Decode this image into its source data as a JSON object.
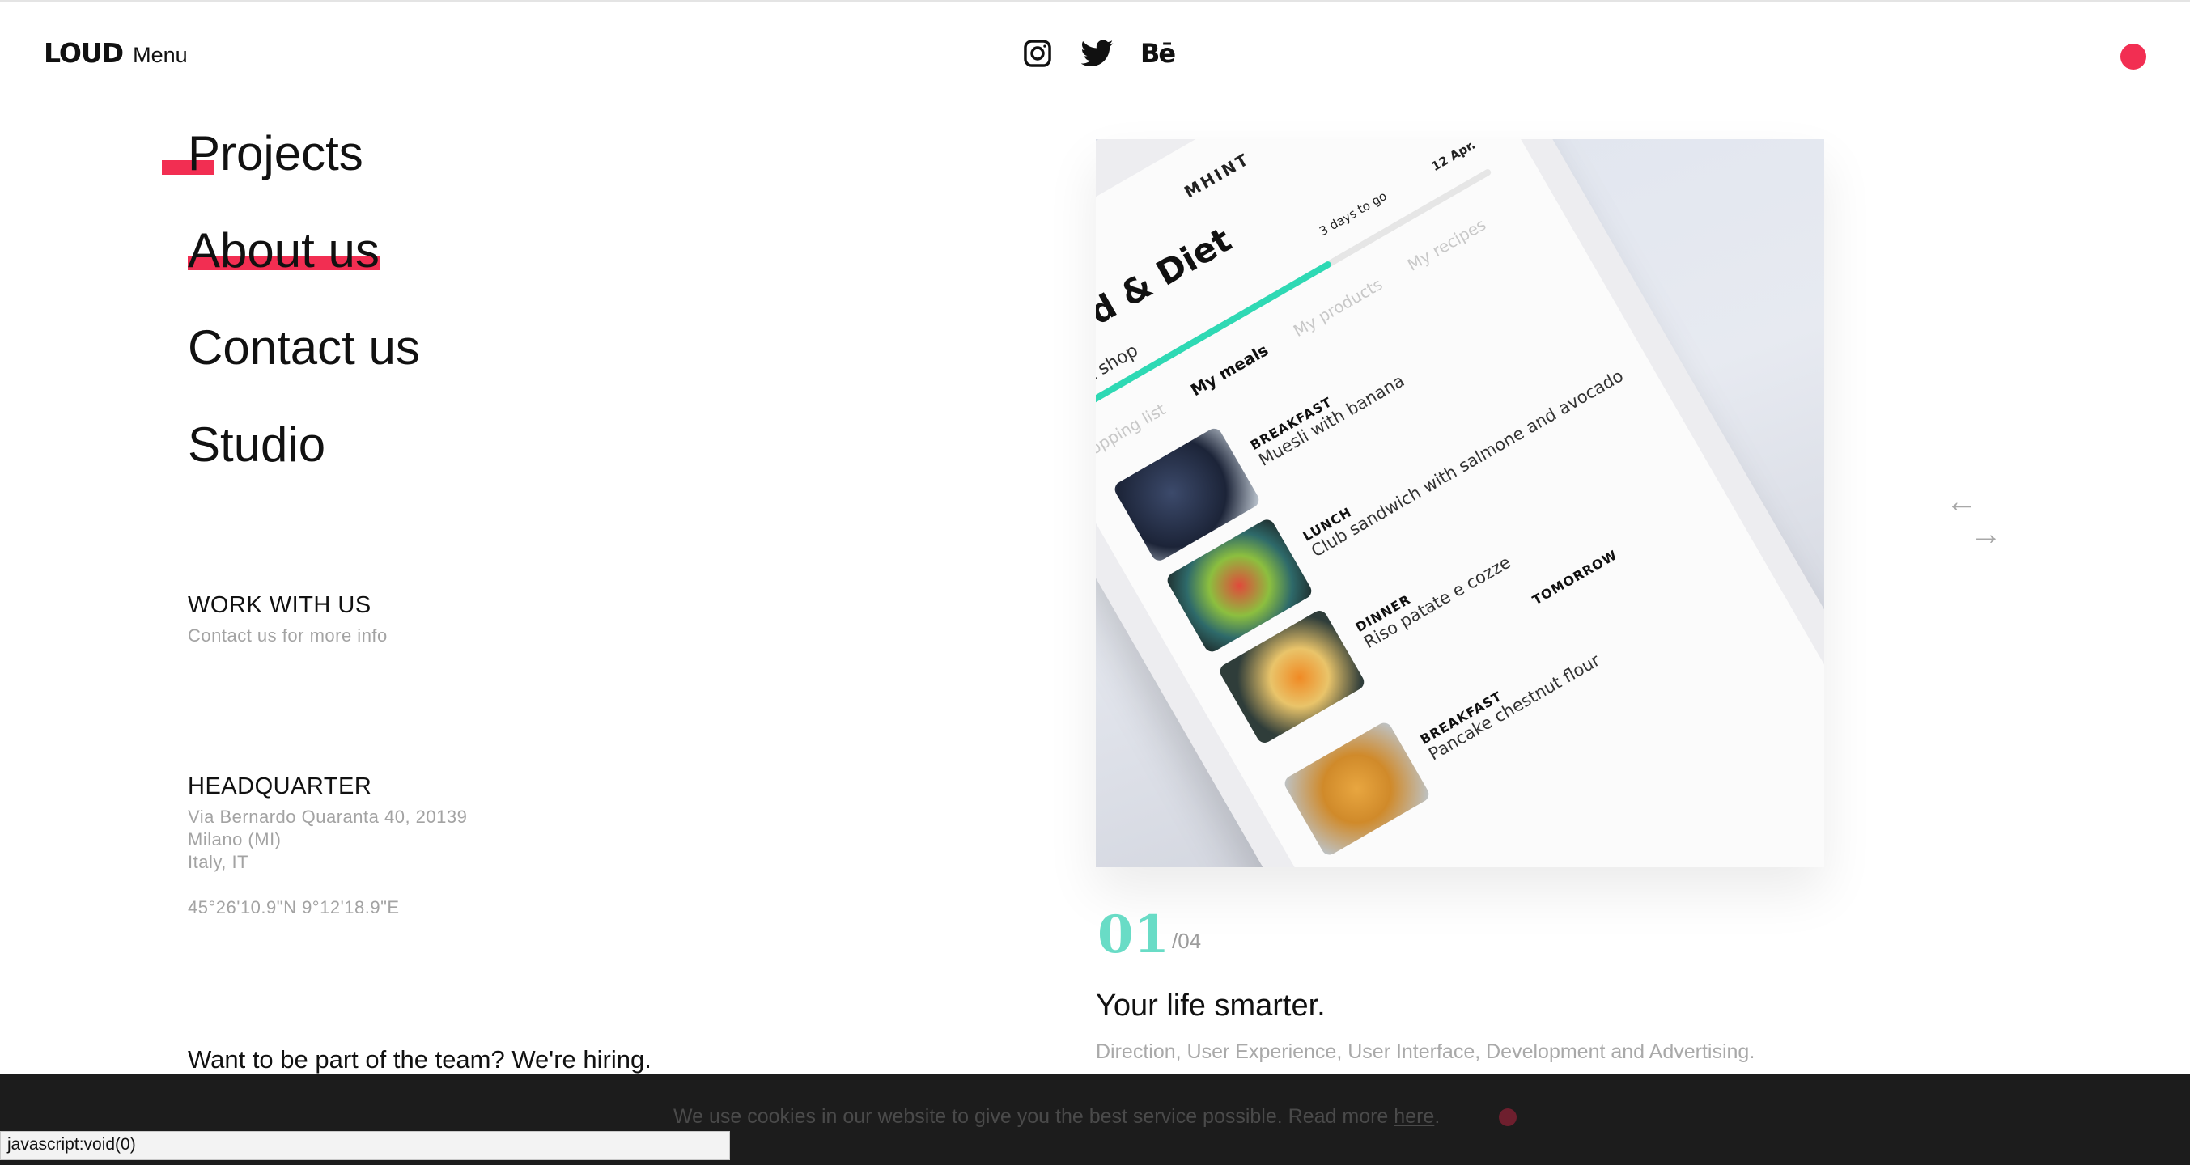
{
  "header": {
    "logo": "LOUD",
    "menu_label": "Menu",
    "socials": [
      {
        "name": "instagram-icon"
      },
      {
        "name": "twitter-icon"
      },
      {
        "name": "behance-icon",
        "glyph": "Bē"
      }
    ],
    "accent_color": "#f22e52"
  },
  "nav": {
    "items": [
      "Projects",
      "About us",
      "Contact us",
      "Studio"
    ]
  },
  "work": {
    "heading": "WORK WITH US",
    "text": "Contact us for more info"
  },
  "hq": {
    "heading": "HEADQUARTER",
    "line1": "Via Bernardo Quaranta 40, 20139",
    "line2": "Milano (MI)",
    "line3": "Italy, IT",
    "coords": "45°26'10.9\"N 9°12'18.9\"E"
  },
  "hiring": "Want to be part of the team? We're hiring.",
  "phone_screen": {
    "brandmark": "MHINT",
    "title": "Food & Diet",
    "next_shop": "Next shop",
    "progress_fraction": 0.62,
    "days_to_go": "3 days to go",
    "date": "12 Apr.",
    "tabs": [
      "opping list",
      "My meals",
      "My products",
      "My recipes"
    ],
    "meals": [
      {
        "label": "BREAKFAST",
        "name": "Muesli with banana"
      },
      {
        "label": "LUNCH",
        "name": "Club sandwich with salmone and avocado"
      },
      {
        "label": "DINNER",
        "name": "Riso patate e cozze"
      },
      {
        "label": "BREAKFAST",
        "name": "Pancake chestnut flour"
      }
    ],
    "tomorrow": "TOMORROW",
    "accent_color": "#2ed9b4"
  },
  "project": {
    "number": "01",
    "total": "/04",
    "title": "Your life smarter.",
    "description": "Direction, User Experience, User Interface, Development and Advertising.",
    "arrow_prev": "←",
    "arrow_next": "→",
    "number_color": "#69dcc6"
  },
  "cookie": {
    "text": "We use cookies in our website to give you the best service possible. Read more",
    "link": "here",
    "suffix": "."
  },
  "status_bar": "javascript:void(0)"
}
